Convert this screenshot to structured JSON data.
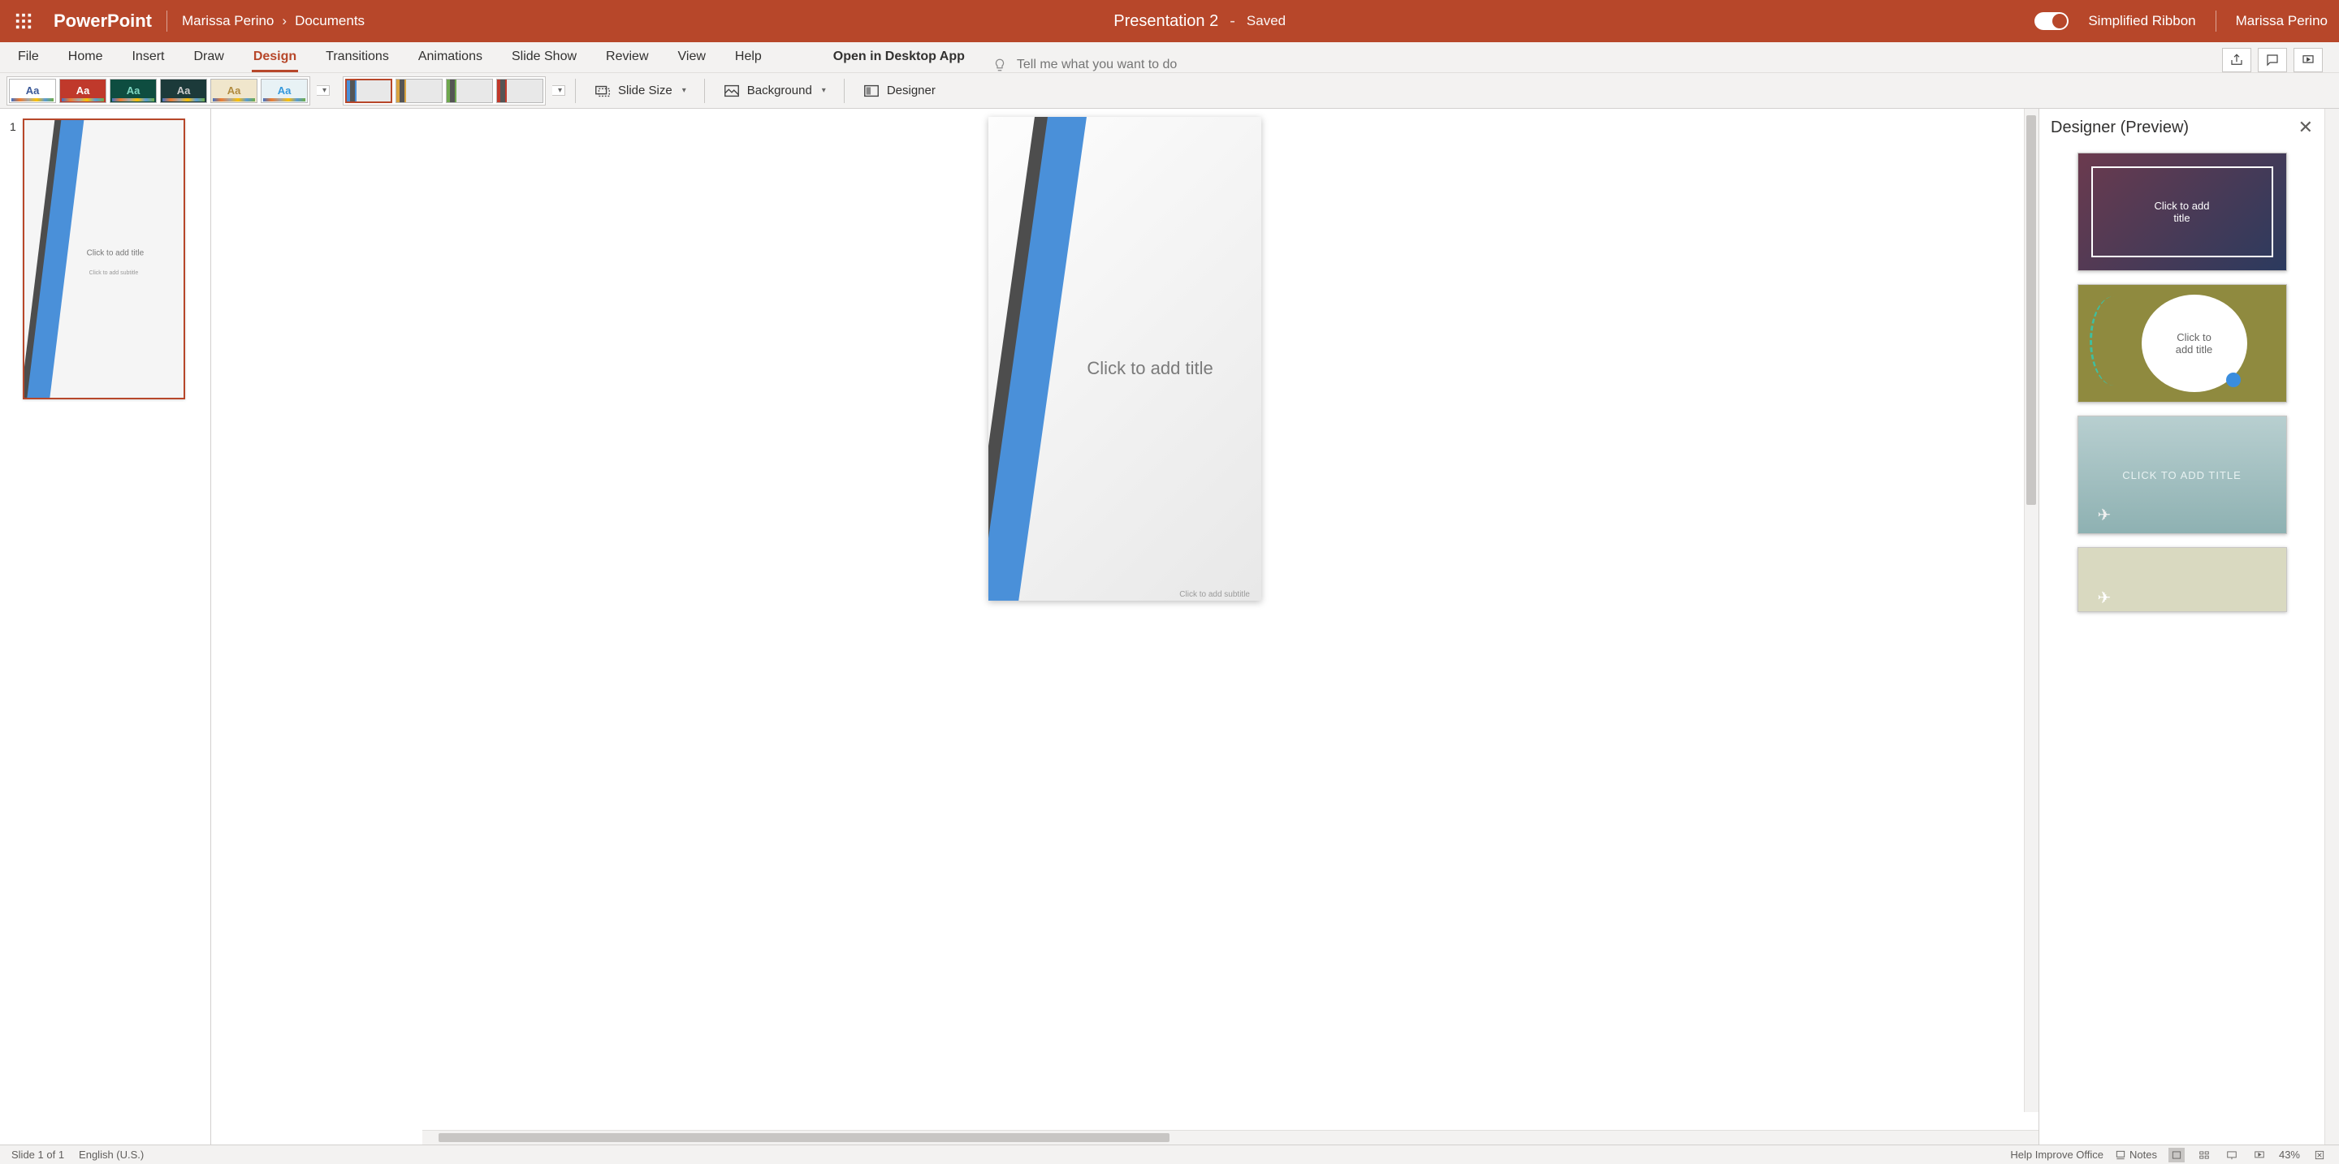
{
  "title_bar": {
    "app_name": "PowerPoint",
    "breadcrumb_user": "Marissa Perino",
    "breadcrumb_loc": "Documents",
    "file_name": "Presentation 2",
    "save_state": "Saved",
    "simplified_ribbon": "Simplified Ribbon",
    "account_name": "Marissa Perino"
  },
  "tabs": {
    "file": "File",
    "home": "Home",
    "insert": "Insert",
    "draw": "Draw",
    "design": "Design",
    "transitions": "Transitions",
    "animations": "Animations",
    "slideshow": "Slide Show",
    "review": "Review",
    "view": "View",
    "help": "Help",
    "open_desktop": "Open in Desktop App",
    "search_placeholder": "Tell me what you want to do"
  },
  "ribbon": {
    "slide_size": "Slide Size",
    "background": "Background",
    "designer": "Designer"
  },
  "slide": {
    "title_placeholder": "Click to add title",
    "subtitle_placeholder": "Click to add subtitle"
  },
  "thumbnails": {
    "n1": "1",
    "title_placeholder": "Click to add title",
    "subtitle_placeholder": "Click to add subtitle"
  },
  "designer_pane": {
    "title": "Designer (Preview)",
    "card_text_1a": "Click to add",
    "card_text_1b": "title",
    "card_text_2a": "Click to",
    "card_text_2b": "add title",
    "card_text_3": "CLICK TO ADD TITLE"
  },
  "status": {
    "slide_count": "Slide 1 of 1",
    "language": "English (U.S.)",
    "help_improve": "Help Improve Office",
    "notes": "Notes",
    "zoom": "43%"
  }
}
